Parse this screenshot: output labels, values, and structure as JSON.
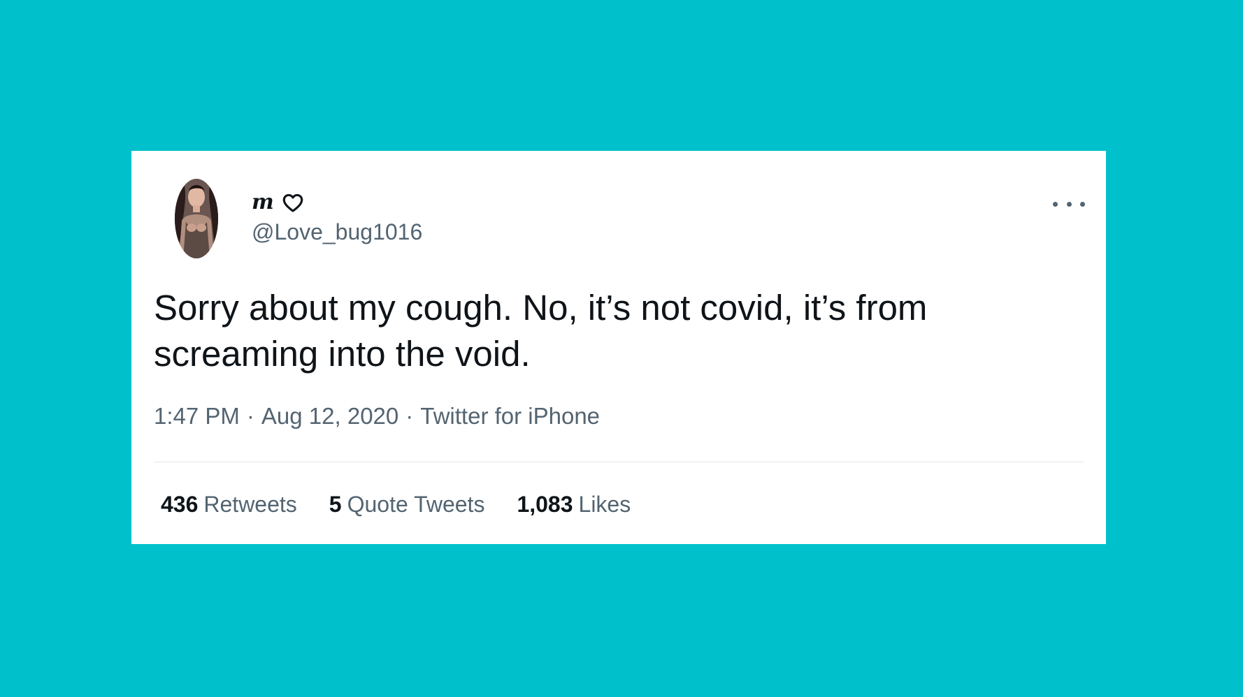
{
  "colors": {
    "background": "#00c1cb",
    "card": "#ffffff",
    "primary_text": "#0f1419",
    "secondary_text": "#536471"
  },
  "author": {
    "display_name": "m",
    "name_emoji": "heart-outline-icon",
    "handle": "@Love_bug1016",
    "avatar": "avatar-photo"
  },
  "tweet": {
    "text": "Sorry about my cough. No, it’s not covid, it’s from screaming into the void.",
    "time": "1:47 PM",
    "date": "Aug 12, 2020",
    "source": "Twitter for iPhone",
    "separator": "·"
  },
  "stats": {
    "retweets_count": "436",
    "retweets_label": "Retweets",
    "quotes_count": "5",
    "quotes_label": "Quote Tweets",
    "likes_count": "1,083",
    "likes_label": "Likes"
  },
  "menu": {
    "more_icon": "more-options-icon"
  }
}
